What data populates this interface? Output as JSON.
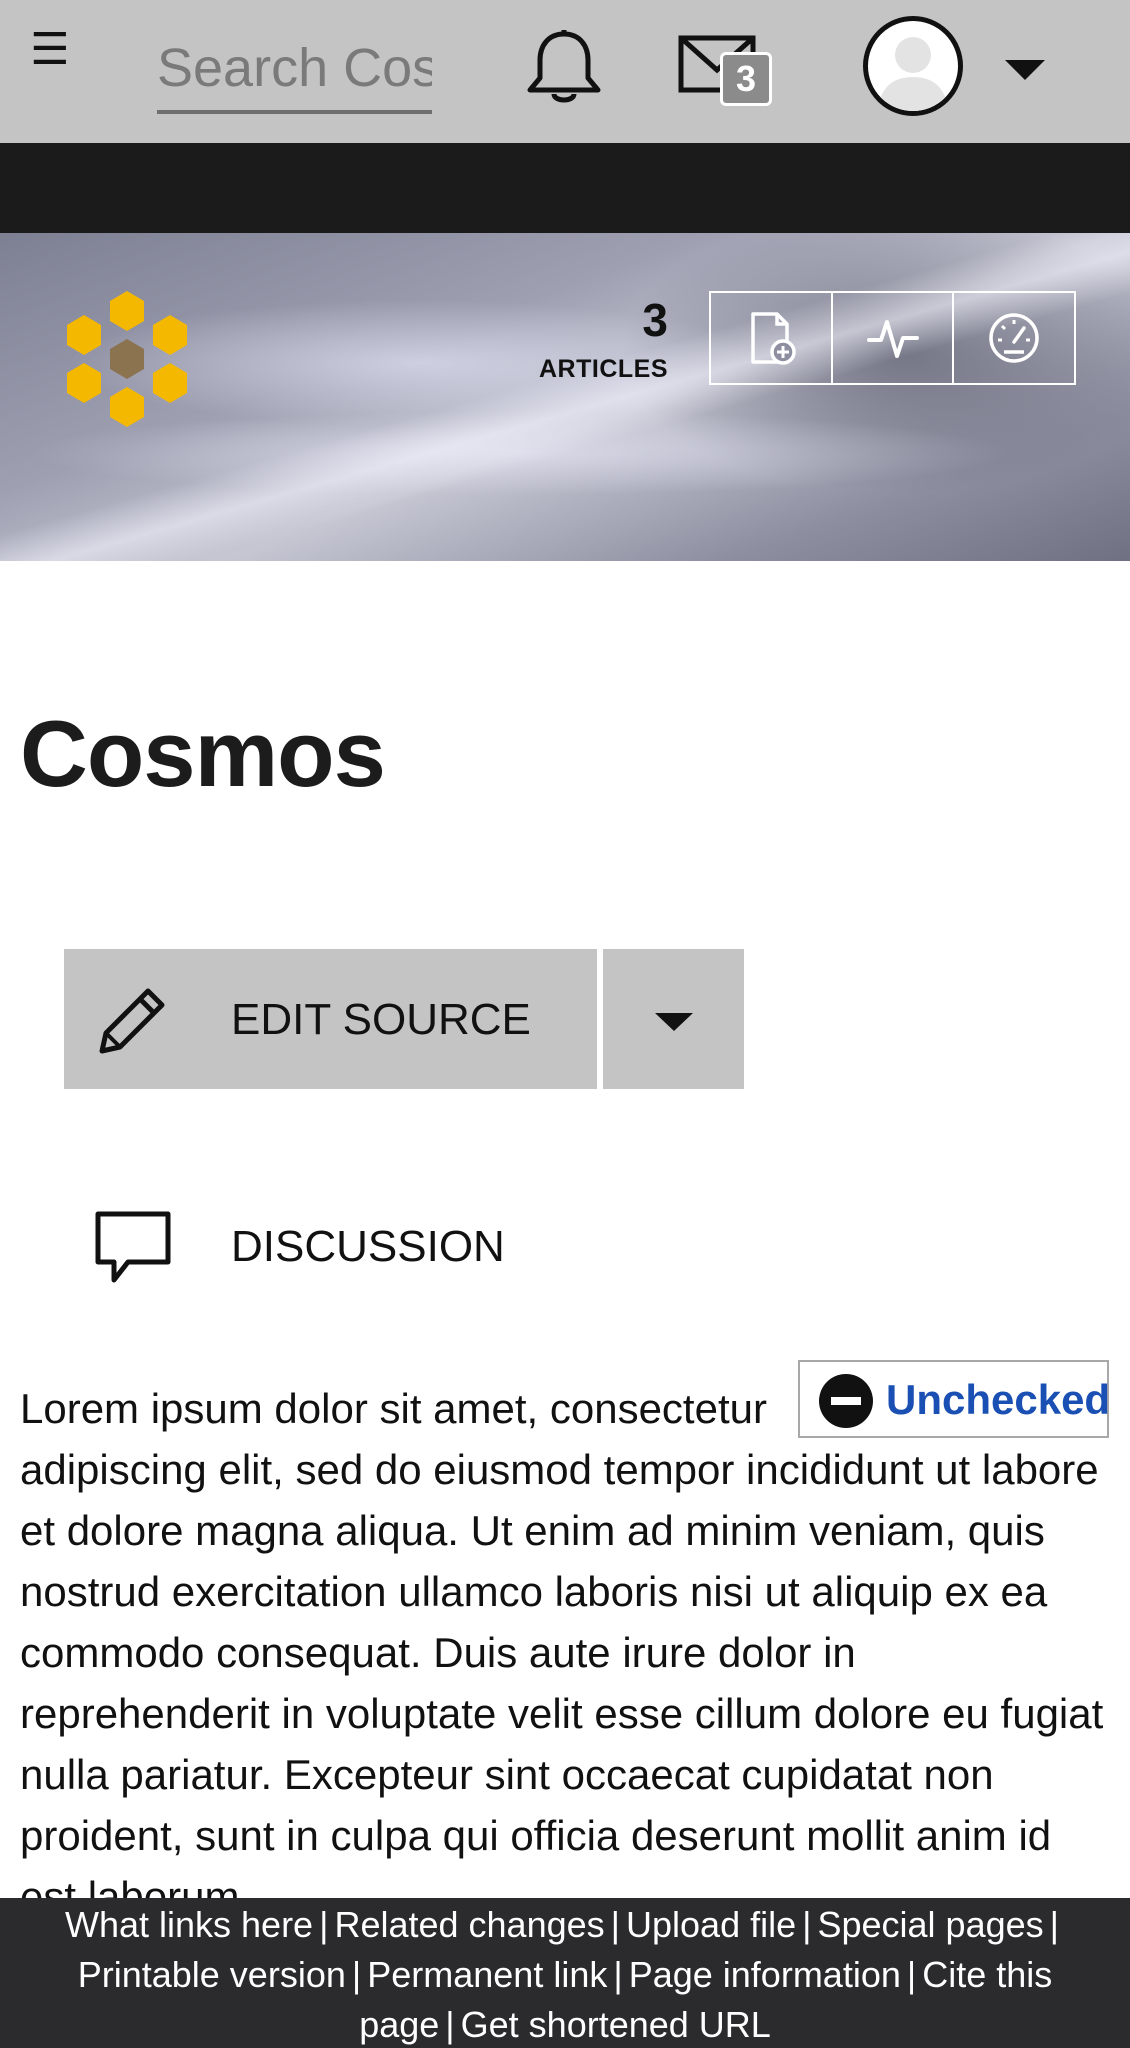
{
  "header": {
    "menu_glyph": "☰",
    "search_placeholder": "Search Cosmos",
    "notifications_icon": "bell-icon",
    "messages_icon": "mail-icon",
    "messages_count": "3",
    "avatar_icon": "user-avatar-icon"
  },
  "hero": {
    "articles_count": "3",
    "articles_label": "ARTICLES",
    "tools": [
      {
        "icon": "add-page-icon"
      },
      {
        "icon": "activity-icon"
      },
      {
        "icon": "dashboard-icon"
      }
    ]
  },
  "page": {
    "title": "Cosmos",
    "edit_source_label": "EDIT SOURCE",
    "discussion_label": "DISCUSSION",
    "status_label": "Unchecked",
    "body": "Lorem ipsum dolor sit amet, consectetur adipiscing elit, sed do eiusmod tempor incididunt ut labore et dolore magna aliqua. Ut enim ad minim veniam, quis nostrud exercitation ullamco laboris nisi ut aliquip ex ea commodo consequat. Duis aute irure dolor in reprehenderit in voluptate velit esse cillum dolore eu fugiat nulla pariatur. Excepteur sint occaecat cupidatat non proident, sunt in culpa qui officia deserunt mollit anim id est laborum."
  },
  "footer": {
    "links": [
      "What links here",
      "Related changes",
      "Upload file",
      "Special pages",
      "Printable version",
      "Permanent link",
      "Page information",
      "Cite this page",
      "Get shortened URL"
    ]
  },
  "colors": {
    "topbar": "#c4c4c4",
    "dark_strip": "#1b1b1c",
    "logo_hex": "#f5b800",
    "logo_center": "#8b7350",
    "status_link": "#1a4fb3",
    "footer_bg": "#2b2b2d"
  }
}
